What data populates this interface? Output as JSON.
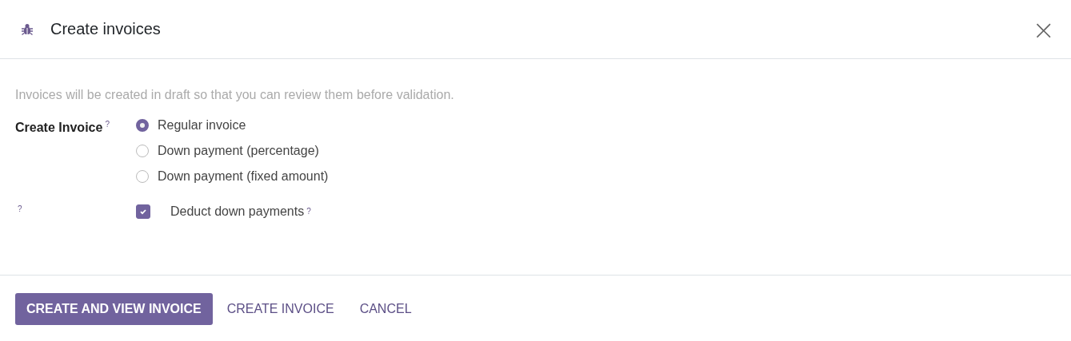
{
  "dialog": {
    "title": "Create invoices",
    "close": "×"
  },
  "intro": "Invoices will be created in draft so that you can review them before validation.",
  "invoice_field": {
    "label": "Create Invoice",
    "help": "?",
    "options": [
      {
        "label": "Regular invoice",
        "selected": true
      },
      {
        "label": "Down payment (percentage)",
        "selected": false
      },
      {
        "label": "Down payment (fixed amount)",
        "selected": false
      }
    ]
  },
  "deduct_field": {
    "help": "?",
    "label": "Deduct down payments",
    "label_help": "?",
    "checked": true
  },
  "buttons": [
    {
      "label": "CREATE AND VIEW INVOICE",
      "kind": "primary"
    },
    {
      "label": "CREATE INVOICE",
      "kind": "link"
    },
    {
      "label": "CANCEL",
      "kind": "link"
    }
  ]
}
